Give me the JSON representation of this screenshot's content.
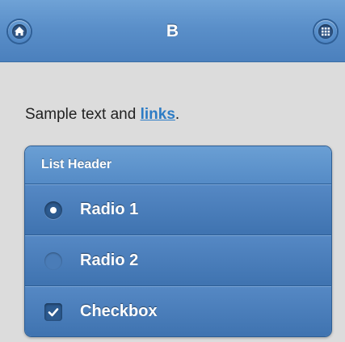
{
  "header": {
    "title": "B",
    "left_icon": "home-icon",
    "right_icon": "grid-icon"
  },
  "content": {
    "text_before": "Sample text and ",
    "link_text": "links",
    "text_after": "."
  },
  "list": {
    "header": "List Header",
    "items": [
      {
        "label": "Radio 1",
        "type": "radio",
        "checked": true
      },
      {
        "label": "Radio 2",
        "type": "radio",
        "checked": false
      },
      {
        "label": "Checkbox",
        "type": "checkbox",
        "checked": true
      }
    ]
  },
  "colors": {
    "header_blue": "#5a8fc9",
    "list_blue": "#4a7dba",
    "link": "#2d7cc5",
    "background": "#dcdcdc"
  }
}
